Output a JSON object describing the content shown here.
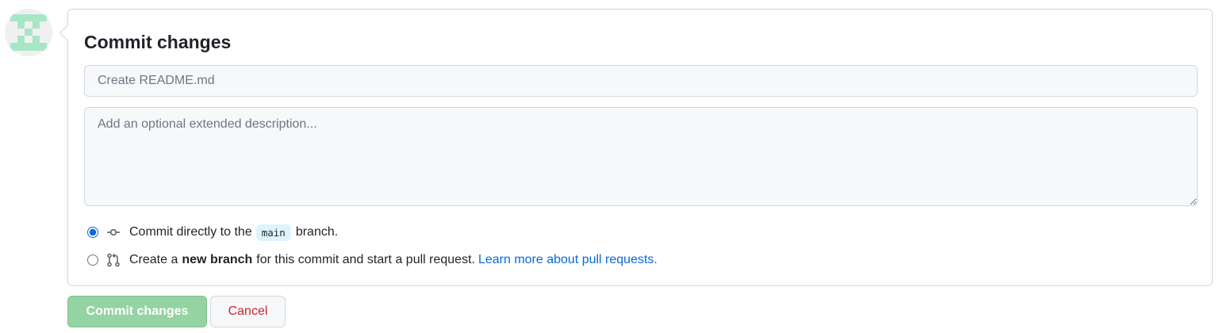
{
  "avatar": {
    "icon": "identicon-avatar",
    "color": "#a8e6c8"
  },
  "commit_form": {
    "title": "Commit changes",
    "summary": {
      "value": "",
      "placeholder": "Create README.md"
    },
    "description": {
      "value": "",
      "placeholder": "Add an optional extended description..."
    },
    "options": [
      {
        "selected": true,
        "icon": "git-commit-icon",
        "text_before": "Commit directly to the",
        "branch": "main",
        "text_after": "branch."
      },
      {
        "selected": false,
        "icon": "git-pull-request-icon",
        "text_before": "Create a",
        "bold": "new branch",
        "text_after": "for this commit and start a pull request.",
        "link": "Learn more about pull requests."
      }
    ]
  },
  "buttons": {
    "commit_label": "Commit changes",
    "cancel_label": "Cancel"
  },
  "colors": {
    "accent": "#0969da",
    "commit_button": "#94d3a2",
    "cancel_text": "#cf222e",
    "input_bg": "#f6f8fa",
    "border": "#d0d7de",
    "branch_chip": "#ddf4ff"
  }
}
